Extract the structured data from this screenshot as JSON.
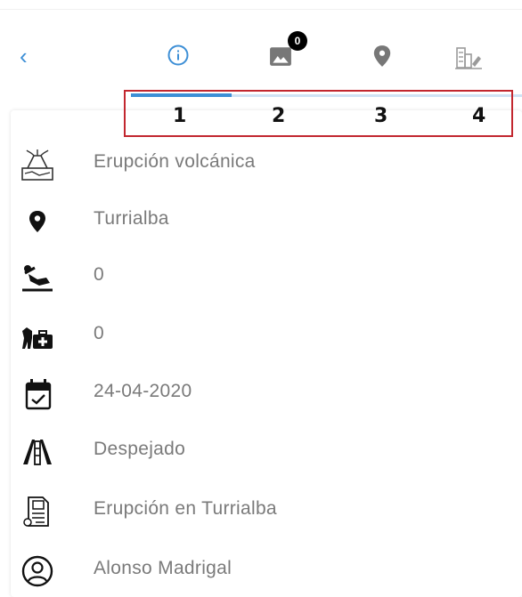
{
  "tabs": {
    "back_label": "‹",
    "photo_count": "0",
    "numbers": [
      "1",
      "2",
      "3",
      "4"
    ],
    "active_index": 0
  },
  "details": {
    "event_type": "Erupción volcánica",
    "location": "Turrialba",
    "injured": "0",
    "animals": "0",
    "date": "24-04-2020",
    "road_status": "Despejado",
    "description": "Erupción en Turrialba",
    "reporter": "Alonso  Madrigal"
  },
  "colors": {
    "accent": "#3d8fd6",
    "highlight_border": "#c2272f",
    "text": "#7a7a7a"
  },
  "icons": [
    "volcano-icon",
    "location-pin-icon",
    "injured-person-icon",
    "animal-care-icon",
    "calendar-check-icon",
    "road-icon",
    "document-icon",
    "user-icon"
  ]
}
